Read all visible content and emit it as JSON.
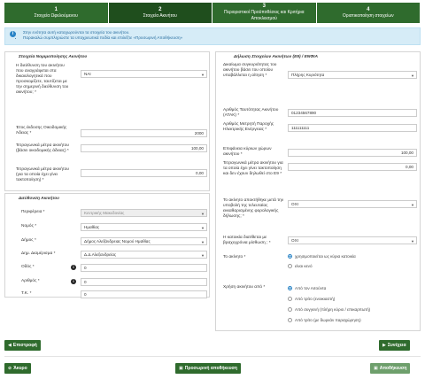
{
  "steps": [
    {
      "num": "1",
      "label": "Στοιχεία Ωφελούμενου"
    },
    {
      "num": "2",
      "label": "Στοιχεία Ακινήτου"
    },
    {
      "num": "3",
      "label": "Περιοριστικοί Προϋποθέσεις και Κριτήρια Αποκλεισμού"
    },
    {
      "num": "4",
      "label": "Οριστικοποίηση στοιχείων"
    }
  ],
  "info": {
    "lines": [
      "Στην ενότητα αυτή καταχωρούνται τα στοιχεία του ακινήτου.",
      "Παρακαλώ συμπληρώστε τα υποχρεωτικά πεδία και επιλέξτε «Προσωρινή Αποθήκευση»"
    ]
  },
  "left": {
    "title1": "Στοιχεία Νομιμοποίησης Ακινήτου",
    "q_address_label": "Η διεύθυνση του ακινήτου που αναγράφεται στα δικαιολογητικά που προσκομίζετε, ταυτίζεται με την σημερινή διεύθυνση του ακινήτου; *",
    "q_address_value": "ΝΑΙ",
    "year_label": "Έτος έκδοσης Οικοδομικής Άδειας *",
    "year_value": "2000",
    "sqm_label": "Τετραγωνικά μέτρα ακινήτου (βάσει οικοδομικής άδειας) *",
    "sqm_value": "100,00",
    "sqm_reg_label": "Τετραγωνικά μέτρα ακινήτου (για τα οποία έχει γίνει τακτοποίηση) *",
    "sqm_reg_value": "0,00",
    "title2": "Διεύθυνση Ακινήτου",
    "region_label": "Περιφέρεια *",
    "region_value": "Κεντρικής Μακεδονίας",
    "prefecture_label": "Νομός *",
    "prefecture_value": "Ημαθίας",
    "municipality_label": "Δήμος *",
    "municipality_value": "Δήμος Αλεξάνδρειας Νομού Ημαθίας",
    "district_label": "Δημ. Διαμέρισμα *",
    "district_value": "Δ.Δ.Αλεξανδρείας",
    "street_label": "Οδός *",
    "street_value": "0",
    "number_label": "Αριθμός *",
    "number_value": "0",
    "zip_label": "Τ.Κ. *",
    "zip_value": "0"
  },
  "right": {
    "title": "Δήλωση Στοιχείων Ακινήτων (Ε9) / ΕΝΦΙΑ",
    "rights_label": "Δικαίωμα συγκυριότητας του ακινήτου βάσει του οποίου υπαβάλλεται η αίτηση *",
    "rights_value": "Πλήρης Κυριότητα",
    "atak_label": "Αριθμός Ταυτότητας Ακινήτου (ΑΤΑΚ) *",
    "atak_value": "01234567890",
    "meter_label": "Αριθμός Μετρητή Παροχής Ηλεκτρικής Ενέργειας *",
    "meter_value": "111111111",
    "main_sqm_label": "Επιφάνεια κύριων χώρων ακινήτου *",
    "main_sqm_value": "100,00",
    "undeclared_label": "Τετραγωνικά μέτρα ακινήτου για τα οποία έχει γίνει τακτοποίηση και δεν έχουν δηλωθεί στο Ε9 *",
    "undeclared_value": "0,00",
    "tax_label": "Το ακίνητο αποκτήθηκε μετά την υποβολή της τελευταίας εκκαθαρισμένης φορολογικής δήλωσης; *",
    "tax_value": "ΟΧΙ",
    "lease_label": "Η κατοικία διατίθεται με βραχυχρόνια μίσθωση ; *",
    "lease_value": "ΟΧΙ",
    "property_label": "Το ακίνητο *",
    "property_options": [
      "χρησιμοποιείται ως κύρια κατοικία",
      "είναι κενό"
    ],
    "use_label": "Χρήση ακινήτου από *",
    "use_options": [
      "Από τον Αιτούντα",
      "Από τρίτο (ενοικιαστή)",
      "Από συγγενή (πλήρη κύριο / επικαρπωτή)",
      "Από τρίτο (με δωρεάν παραχώρηση)"
    ]
  },
  "buttons": {
    "back": "Επιστροφή",
    "next": "Συνέχεια",
    "cancel": "Άκυρο",
    "temp_save": "Προσωρινή αποθήκευση",
    "save": "Αποθήκευση"
  },
  "colors": {
    "primary": "#2f6b2d",
    "primary_active": "#1f4e1d",
    "info_bg": "#d6ecf7",
    "info_text": "#2a6fa0"
  }
}
